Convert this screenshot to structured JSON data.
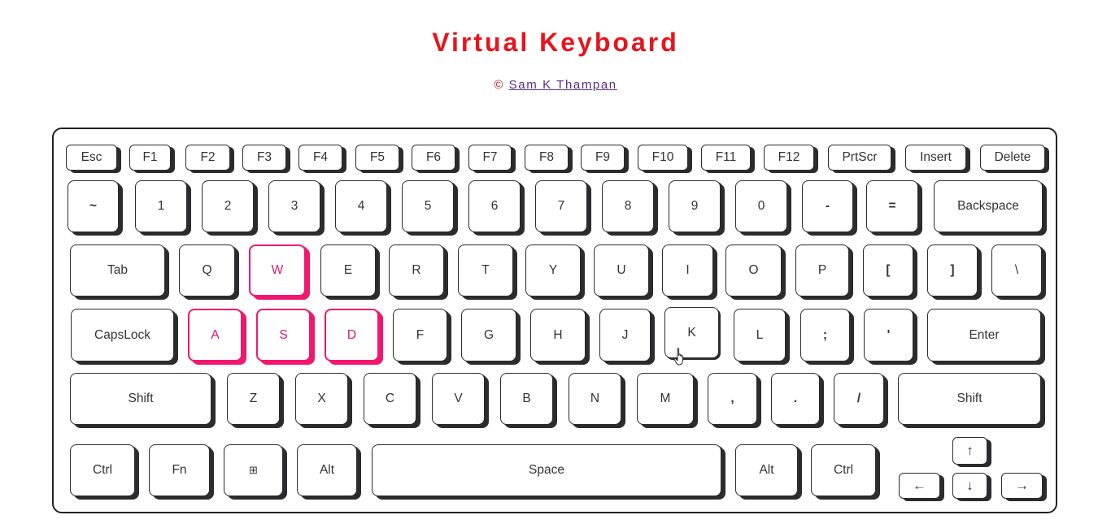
{
  "page": {
    "title": "Virtual Keyboard",
    "copyright_symbol": "©",
    "author_link": "Sam K Thampan"
  },
  "keys": {
    "esc": "Esc",
    "f1": "F1",
    "f2": "F2",
    "f3": "F3",
    "f4": "F4",
    "f5": "F5",
    "f6": "F6",
    "f7": "F7",
    "f8": "F8",
    "f9": "F9",
    "f10": "F10",
    "f11": "F11",
    "f12": "F12",
    "prtscr": "PrtScr",
    "insert": "Insert",
    "delete": "Delete",
    "tilde": "~",
    "d1": "1",
    "d2": "2",
    "d3": "3",
    "d4": "4",
    "d5": "5",
    "d6": "6",
    "d7": "7",
    "d8": "8",
    "d9": "9",
    "d0": "0",
    "minus": "-",
    "equals": "=",
    "backspace": "Backspace",
    "tab": "Tab",
    "q": "Q",
    "w": "W",
    "e": "E",
    "r": "R",
    "t": "T",
    "y": "Y",
    "u": "U",
    "i": "I",
    "o": "O",
    "p": "P",
    "lbracket": "[",
    "rbracket": "]",
    "backslash": "\\",
    "capslock": "CapsLock",
    "a": "A",
    "s": "S",
    "d": "D",
    "f": "F",
    "g": "G",
    "h": "H",
    "j": "J",
    "k": "K",
    "l": "L",
    "semicolon": ";",
    "quote": "'",
    "enter": "Enter",
    "shift_left": "Shift",
    "z": "Z",
    "x": "X",
    "c": "C",
    "v": "V",
    "b": "B",
    "n": "N",
    "m": "M",
    "comma": ",",
    "period": ".",
    "slash": "/",
    "shift_right": "Shift",
    "ctrl_left": "Ctrl",
    "fn": "Fn",
    "win": "⊞",
    "alt_left": "Alt",
    "space": "Space",
    "alt_right": "Alt",
    "ctrl_right": "Ctrl",
    "arrow_up": "↑",
    "arrow_left": "←",
    "arrow_down": "↓",
    "arrow_right": "→"
  },
  "highlighted_keys": [
    "W",
    "A",
    "S",
    "D"
  ],
  "pressed_key": "K",
  "colors": {
    "title": "#e8141b",
    "highlight": "#f0186e",
    "key_shadow": "#2c2c2e"
  }
}
